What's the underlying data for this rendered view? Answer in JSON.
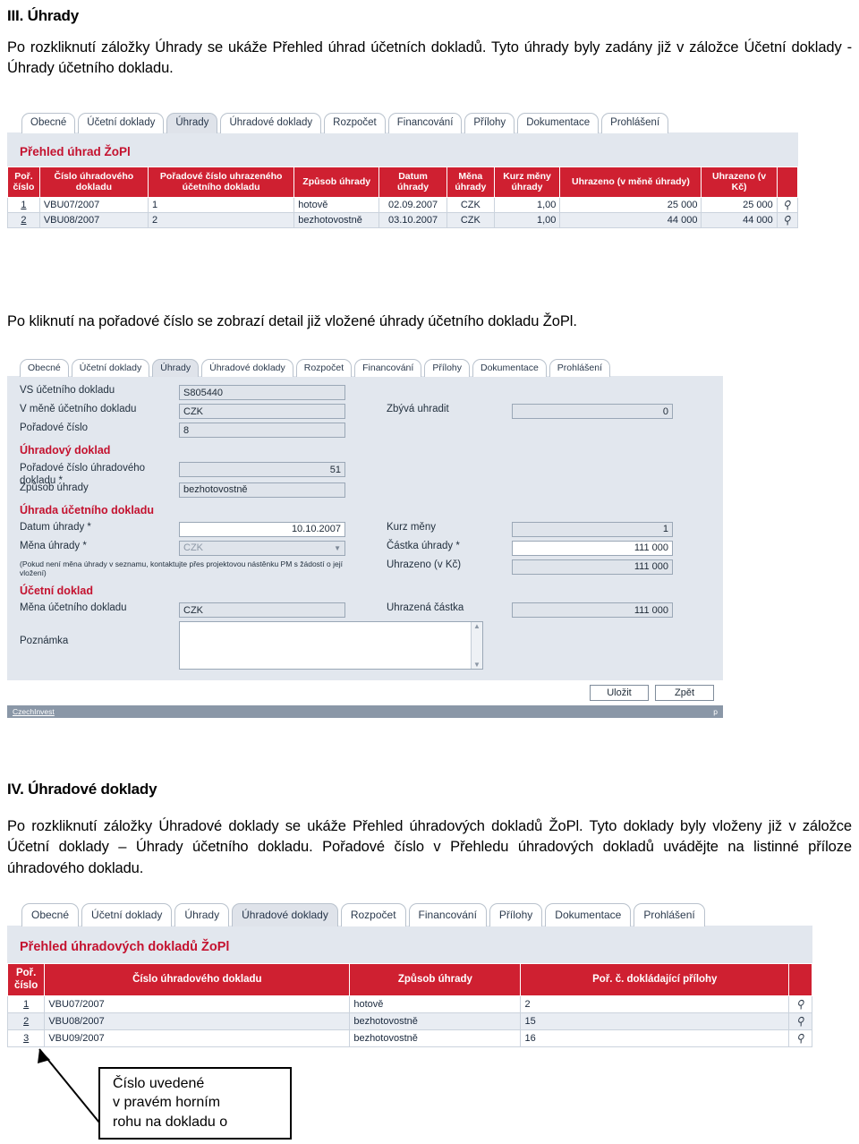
{
  "document": {
    "section3": {
      "heading": "III. Úhrady",
      "paragraph": "Po rozkliknutí záložky Úhrady se ukáže Přehled úhrad účetních dokladů. Tyto úhrady byly zadány již v záložce Účetní doklady - Úhrady účetního dokladu.",
      "paragraph2": "Po kliknutí na pořadové číslo se zobrazí detail již vložené úhrady účetního dokladu ŽoPl."
    },
    "section4": {
      "heading": "IV. Úhradové doklady",
      "paragraph": "Po rozkliknutí záložky Úhradové doklady se ukáže Přehled úhradových dokladů ŽoPl. Tyto doklady byly vloženy již v záložce Účetní doklady – Úhrady účetního dokladu. Pořadové číslo v Přehledu úhradových dokladů uvádějte na listinné příloze úhradového dokladu."
    }
  },
  "colors": {
    "table_header_red": "#cf2031",
    "title_red": "#c4122f",
    "panel_bg": "#e2e7ee",
    "annotation_red": "#8d1f24"
  },
  "tabs": [
    "Obecné",
    "Účetní doklady",
    "Úhrady",
    "Úhradové doklady",
    "Rozpočet",
    "Financování",
    "Přílohy",
    "Dokumentace",
    "Prohlášení"
  ],
  "screenshot1": {
    "active_tab": "Úhrady",
    "panel_title": "Přehled úhrad ŽoPl",
    "table": {
      "headers": [
        "Poř. číslo",
        "Číslo úhradového dokladu",
        "Pořadové číslo uhrazeného účetního dokladu",
        "Způsob úhrady",
        "Datum úhrady",
        "Měna úhrady",
        "Kurz měny úhrady",
        "Uhrazeno (v měně úhrady)",
        "Uhrazeno (v Kč)"
      ],
      "rows": [
        {
          "por": "1",
          "cislo": "VBU07/2007",
          "poradove": "1",
          "zpusob": "hotově",
          "datum": "02.09.2007",
          "mena": "CZK",
          "kurz": "1,00",
          "uhrazeno_mena": "25 000",
          "uhrazeno_kc": "25 000",
          "icon": "pencil-icon"
        },
        {
          "por": "2",
          "cislo": "VBU08/2007",
          "poradove": "2",
          "zpusob": "bezhotovostně",
          "datum": "03.10.2007",
          "mena": "CZK",
          "kurz": "1,00",
          "uhrazeno_mena": "44 000",
          "uhrazeno_kc": "44 000",
          "icon": "pencil-icon"
        }
      ]
    }
  },
  "screenshot2": {
    "active_tab": "Úhrady",
    "fields": {
      "vs_label": "VS účetního dokladu",
      "vs_value": "S805440",
      "mena_ucet_label": "V měně účetního dokladu",
      "mena_ucet_value": "CZK",
      "poradove_label": "Pořadové číslo",
      "poradove_value": "8",
      "zbyva_label": "Zbývá uhradit",
      "zbyva_value": "0"
    },
    "section_uhradovy": {
      "title": "Úhradový doklad",
      "por_label": "Pořadové číslo úhradového dokladu *",
      "por_value": "51",
      "zpusob_label": "Způsob úhrady",
      "zpusob_value": "bezhotovostně"
    },
    "section_uhrada": {
      "title": "Úhrada účetního dokladu",
      "datum_label": "Datum úhrady *",
      "datum_value": "10.10.2007",
      "mena_label": "Měna úhrady *",
      "mena_value": "CZK",
      "mena_note": "(Pokud není měna úhrady v seznamu, kontaktujte přes projektovou nástěnku PM s žádostí o její vložení)",
      "kurz_label": "Kurz měny",
      "kurz_value": "1",
      "castka_label": "Částka úhrady *",
      "castka_value": "111 000",
      "uhrazeno_label": "Uhrazeno (v Kč)",
      "uhrazeno_value": "111 000"
    },
    "section_ucetni": {
      "title": "Účetní doklad",
      "mena_label": "Měna účetního dokladu",
      "mena_value": "CZK",
      "uhrazena_label": "Uhrazená částka",
      "uhrazena_value": "111 000",
      "poznamka_label": "Poznámka",
      "poznamka_value": ""
    },
    "buttons": {
      "save": "Uložit",
      "back": "Zpět"
    },
    "footer": {
      "left": "CzechInvest",
      "right": "p"
    }
  },
  "screenshot3": {
    "active_tab": "Úhradové doklady",
    "panel_title": "Přehled úhradových dokladů ŽoPl",
    "table": {
      "headers": [
        "Poř. číslo",
        "Číslo úhradového dokladu",
        "Způsob úhrady",
        "Poř. č. dokládající přílohy"
      ],
      "rows": [
        {
          "por": "1",
          "cislo": "VBU07/2007",
          "zpusob": "hotově",
          "priloha": "2",
          "icon": "pencil-icon"
        },
        {
          "por": "2",
          "cislo": "VBU08/2007",
          "zpusob": "bezhotovostně",
          "priloha": "15",
          "icon": "pencil-icon"
        },
        {
          "por": "3",
          "cislo": "VBU09/2007",
          "zpusob": "bezhotovostně",
          "priloha": "16",
          "icon": "pencil-icon"
        }
      ]
    }
  },
  "annotation": {
    "callout_line1": "Číslo uvedené",
    "callout_line2": "v pravém horním",
    "callout_line3": "rohu na dokladu o"
  }
}
